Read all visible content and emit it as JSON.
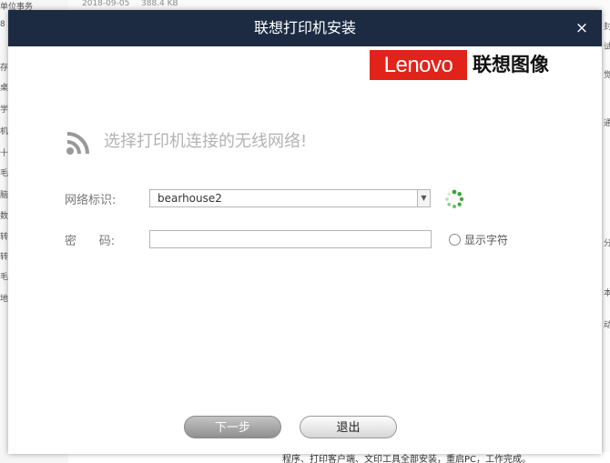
{
  "background": {
    "top_row": {
      "date": "2018-09-05",
      "size": "388.4 KB"
    },
    "left_items": [
      "单位事务",
      "8",
      "存",
      "桌",
      "学",
      "机",
      "十",
      "毛汉",
      "脑",
      "数(",
      "转块",
      "转块",
      "毛汉",
      "地址"
    ],
    "right_items": [
      "封",
      "试",
      "觉",
      "通",
      "分",
      "本",
      "动"
    ],
    "bottom_text": "程序、打印客户端、文印工具全部安装，重启PC，工作完成。"
  },
  "dialog": {
    "title": "联想打印机安装",
    "close_glyph": "×",
    "logo": {
      "brand": "Lenovo",
      "product": "联想图像",
      "brand_color": "#e2231a"
    },
    "heading": "选择打印机连接的无线网络!",
    "network_label": "网络标识:",
    "network_value": "bearhouse2",
    "password_label": "密      码:",
    "password_value": "",
    "show_chars_label": "显示字符",
    "next_button": "下一步",
    "exit_button": "退出"
  },
  "colors": {
    "titlebar": "#1c2b42",
    "spinner": "#3ba53b",
    "heading_text": "#b3b3b3"
  },
  "icons": {
    "heading": "wifi-icon",
    "spinner": "loading-spinner-icon",
    "select": "dropdown-arrow-icon",
    "close": "close-icon"
  }
}
